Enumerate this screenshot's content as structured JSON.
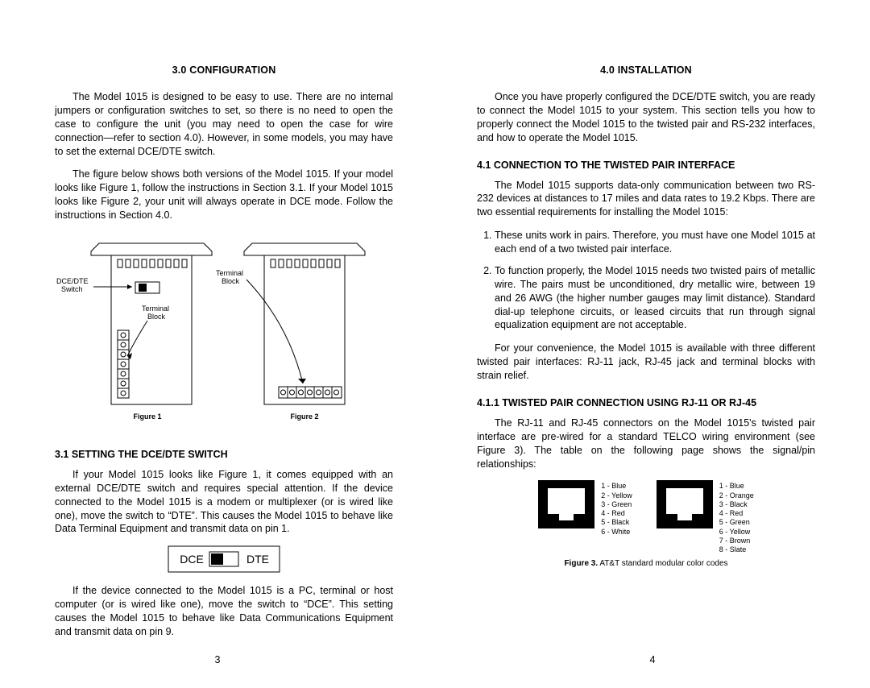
{
  "left": {
    "heading": "3.0  CONFIGURATION",
    "p1": "The Model 1015 is designed to be easy to use.  There are no internal jumpers or configuration switches to set, so there is no need to open the case to configure the unit (you may need to open the case for wire connection—refer to section 4.0).  However, in some models, you may have to set the external DCE/DTE switch.",
    "p2": "The figure below shows both versions of the Model 1015.  If your model looks like Figure 1, follow the instructions in Section 3.1.  If your Model 1015 looks like Figure 2, your unit will always operate in DCE mode.  Follow the instructions in Section 4.0.",
    "fig_labels": {
      "dce_dte_switch": "DCE/DTE\nSwitch",
      "terminal_block_a": "Terminal\nBlock",
      "terminal_block_b": "Terminal\nBlock",
      "figure1": "Figure 1",
      "figure2": "Figure 2"
    },
    "sub_heading": "3.1  SETTING THE DCE/DTE SWITCH",
    "p3": "If your Model 1015 looks like Figure 1, it comes equipped with an external DCE/DTE switch and requires special attention.  If the device connected to the Model 1015 is a modem or multiplexer (or is wired like one), move the switch to “DTE”.  This causes the Model 1015 to behave like Data Terminal Equipment and transmit data on pin 1.",
    "switch": {
      "dce": "DCE",
      "dte": "DTE"
    },
    "p4": "If the device connected to the Model 1015 is a PC, terminal or host computer (or is wired like one), move the switch to “DCE”.  This setting causes the Model 1015 to behave like Data Communications Equipment and transmit data on pin 9.",
    "pagenum": "3"
  },
  "right": {
    "heading": "4.0  INSTALLATION",
    "p1": "Once you have properly configured the DCE/DTE switch, you are ready to connect the Model 1015 to your system.  This section tells you how to properly connect the Model 1015 to the twisted pair and RS-232 interfaces, and how to operate the Model 1015.",
    "sub1": "4.1  CONNECTION TO THE TWISTED PAIR INTERFACE",
    "p2": "The Model 1015 supports data-only communication between two RS-232 devices at distances to 17 miles and data rates to 19.2 Kbps.  There are two essential requirements for installing the Model 1015:",
    "req1": "These units work in pairs.  Therefore, you must have one Model 1015 at each end of a two twisted pair interface.",
    "req2": "To function properly, the Model 1015 needs two twisted pairs of metallic wire.  The pairs must be unconditioned, dry metallic wire, between 19 and 26 AWG (the higher number gauges may limit distance).  Standard dial-up telephone circuits, or leased circuits that run through signal equalization equipment are not acceptable.",
    "p3": "For your convenience, the Model 1015 is available with three different twisted pair interfaces:  RJ-11 jack, RJ-45 jack and terminal blocks with strain relief.",
    "sub2": "4.1.1  TWISTED PAIR CONNECTION USING RJ-11 OR RJ-45",
    "p4": "The RJ-11 and RJ-45 connectors on the Model 1015's twisted pair interface are pre-wired for a standard TELCO wiring environment (see Figure 3).  The table on the following page shows the signal/pin relationships:",
    "rj11_colors": "1 - Blue\n2 - Yellow\n3 - Green\n4 - Red\n5 - Black\n6 - White",
    "rj45_colors": "1 - Blue\n2 - Orange\n3 - Black\n4 - Red\n5 - Green\n6 - Yellow\n7 - Brown\n8 - Slate",
    "fig3_caption_bold": "Figure 3.",
    "fig3_caption_rest": "  AT&T standard modular color codes",
    "pagenum": "4"
  }
}
